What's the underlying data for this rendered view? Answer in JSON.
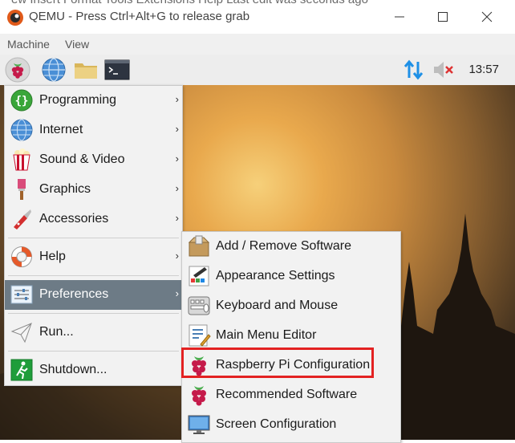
{
  "window": {
    "title": "QEMU - Press Ctrl+Alt+G to release grab",
    "behind_text": "ew   Insert   Format   Tools   Extensions   Help   Last edit was seconds ago",
    "menubar": [
      "Machine",
      "View"
    ]
  },
  "taskbar": {
    "clock": "13:57",
    "icons": [
      "raspberry-menu-icon",
      "globe-icon",
      "folder-icon",
      "terminal-icon",
      "network-updown-icon",
      "volume-muted-icon"
    ]
  },
  "menu": {
    "items": [
      {
        "label": "Programming",
        "icon": "programming-icon",
        "arrow": "›"
      },
      {
        "label": "Internet",
        "icon": "internet-globe-icon",
        "arrow": "›"
      },
      {
        "label": "Sound & Video",
        "icon": "popcorn-icon",
        "arrow": "›"
      },
      {
        "label": "Graphics",
        "icon": "paintbrush-icon",
        "arrow": "›"
      },
      {
        "label": "Accessories",
        "icon": "pocketknife-icon",
        "arrow": "›"
      },
      {
        "label": "Help",
        "icon": "lifebuoy-icon",
        "arrow": "›"
      },
      {
        "label": "Preferences",
        "icon": "preferences-sliders-icon",
        "arrow": "›"
      },
      {
        "label": "Run...",
        "icon": "paper-plane-icon"
      },
      {
        "label": "Shutdown...",
        "icon": "exit-runner-icon"
      }
    ]
  },
  "submenu": {
    "items": [
      {
        "label": "Add / Remove Software",
        "icon": "package-icon"
      },
      {
        "label": "Appearance Settings",
        "icon": "appearance-palette-icon"
      },
      {
        "label": "Keyboard and Mouse",
        "icon": "keyboard-mouse-icon"
      },
      {
        "label": "Main Menu Editor",
        "icon": "menu-editor-icon"
      },
      {
        "label": "Raspberry Pi Configuration",
        "icon": "raspberry-icon"
      },
      {
        "label": "Recommended Software",
        "icon": "raspberry-icon"
      },
      {
        "label": "Screen Configuration",
        "icon": "monitor-icon"
      }
    ]
  },
  "colors": {
    "highlight_border": "#e32222",
    "active_item_bg": "#6d7b86",
    "network_icon": "#1e90e6"
  }
}
